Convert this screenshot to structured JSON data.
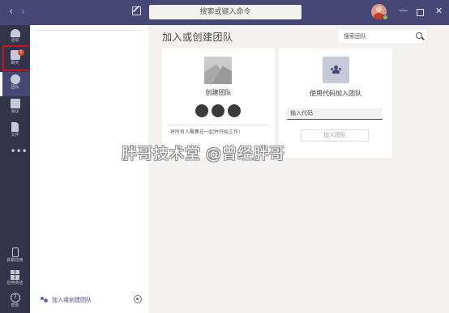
{
  "titlebar": {
    "back_icon": "‹",
    "forward_icon": "›",
    "search_placeholder": "搜索或键入命令",
    "window_controls": {
      "minimize": "—",
      "close": "✕"
    }
  },
  "rail": {
    "items": [
      {
        "id": "activity",
        "label": "活动",
        "icon": "bell-icon"
      },
      {
        "id": "chat",
        "label": "聊天",
        "icon": "chat-icon",
        "badge": "1"
      },
      {
        "id": "teams",
        "label": "团队",
        "icon": "teams-icon",
        "active": true
      },
      {
        "id": "calendar",
        "label": "会议",
        "icon": "calendar-icon"
      },
      {
        "id": "files",
        "label": "文件",
        "icon": "file-icon"
      },
      {
        "id": "more",
        "label": "",
        "icon": "more-icon",
        "glyph": "•••"
      },
      {
        "id": "mobile",
        "label": "获取应用",
        "icon": "phone-icon"
      },
      {
        "id": "store",
        "label": "应用商店",
        "icon": "apps-icon"
      },
      {
        "id": "help",
        "label": "帮助",
        "icon": "help-icon",
        "glyph": "?"
      }
    ]
  },
  "teamlist": {
    "join_create_label": "加入或创建团队"
  },
  "main": {
    "title": "加入或创建团队",
    "search_placeholder": "搜索团队",
    "create_card": {
      "title": "创建团队",
      "description": "将所有人聚集在一起并开始工作!"
    },
    "code_card": {
      "title": "使用代码加入团队",
      "code_placeholder": "输入代码",
      "join_button": "加入团队"
    }
  },
  "watermark": "胖哥技术堂 @曾经胖哥",
  "colors": {
    "titlebar": "#464775",
    "rail": "#33344a",
    "accent": "#6264a7",
    "highlight_box": "#c4161c",
    "badge": "#cc4a31"
  }
}
